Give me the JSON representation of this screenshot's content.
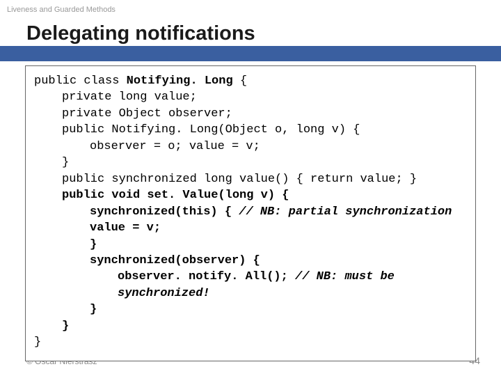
{
  "breadcrumb": "Liveness and Guarded Methods",
  "title": "Delegating notifications",
  "code": {
    "l1a": "public class ",
    "l1b": "Notifying. Long",
    "l1c": " {",
    "l2": "private long value;",
    "l3": "private Object observer;",
    "l4": "public Notifying. Long(Object o, long v) {",
    "l5": "observer = o; value = v;",
    "l6": "}",
    "l7": "public synchronized long value() { return value; }",
    "l8": "public void set. Value(long v) {",
    "l9a": "synchronized(this) { ",
    "l9b": "// NB: partial synchronization",
    "l10": "value = v;",
    "l11": "}",
    "l12": "synchronized(observer) {",
    "l13a": "observer. notify. All(); ",
    "l13b": "// NB: must be synchronized!",
    "l14": "}",
    "l15": "}",
    "l16": "}"
  },
  "footer": {
    "author": "© Oscar Nierstrasz",
    "page": "44"
  }
}
